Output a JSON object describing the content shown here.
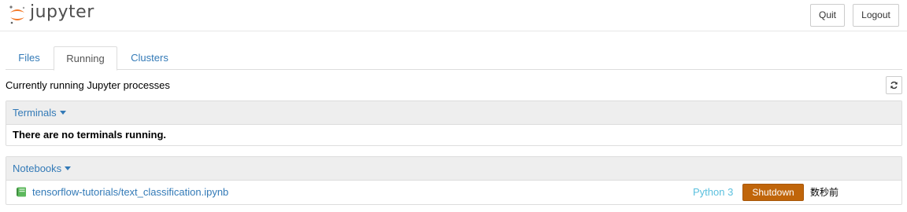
{
  "header": {
    "logo_text": "jupyter",
    "quit_label": "Quit",
    "logout_label": "Logout"
  },
  "tabs": [
    {
      "label": "Files",
      "active": false
    },
    {
      "label": "Running",
      "active": true
    },
    {
      "label": "Clusters",
      "active": false
    }
  ],
  "toolbar": {
    "description": "Currently running Jupyter processes",
    "refresh_icon": "refresh-icon"
  },
  "terminals": {
    "heading": "Terminals",
    "empty_message": "There are no terminals running."
  },
  "notebooks": {
    "heading": "Notebooks",
    "items": [
      {
        "name": "tensorflow-tutorials/text_classification.ipynb",
        "kernel": "Python 3",
        "shutdown_label": "Shutdown",
        "last_activity": "数秒前"
      }
    ]
  },
  "colors": {
    "link": "#337ab7",
    "kernel": "#5bc0de",
    "shutdown": "#c0650a",
    "notebook_icon": "#5cb85c",
    "logo_orange": "#f37726"
  }
}
